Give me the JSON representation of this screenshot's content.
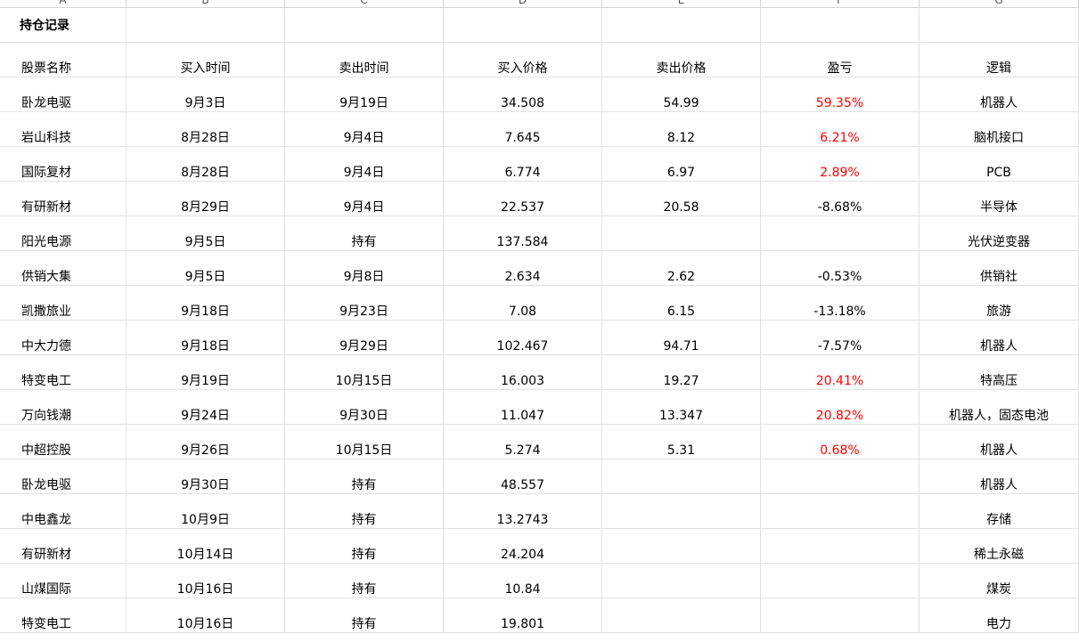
{
  "sheet": {
    "column_letters": [
      "A",
      "B",
      "C",
      "D",
      "E",
      "F",
      "G"
    ],
    "title": "持仓记录",
    "headers": [
      "股票名称",
      "买入时间",
      "卖出时间",
      "买入价格",
      "卖出价格",
      "盈亏",
      "逻辑"
    ],
    "colors": {
      "profit": "#ff0000",
      "loss": "#000000",
      "grid": "#e2e2e2"
    },
    "rows": [
      {
        "name": "卧龙电驱",
        "buy_date": "9月3日",
        "sell_date": "9月19日",
        "buy_price": "34.508",
        "sell_price": "54.99",
        "pnl": "59.35%",
        "pnl_sign": "pos",
        "logic": "机器人"
      },
      {
        "name": "岩山科技",
        "buy_date": "8月28日",
        "sell_date": "9月4日",
        "buy_price": "7.645",
        "sell_price": "8.12",
        "pnl": "6.21%",
        "pnl_sign": "pos",
        "logic": "脑机接口"
      },
      {
        "name": "国际复材",
        "buy_date": "8月28日",
        "sell_date": "9月4日",
        "buy_price": "6.774",
        "sell_price": "6.97",
        "pnl": "2.89%",
        "pnl_sign": "pos",
        "logic": "PCB"
      },
      {
        "name": "有研新材",
        "buy_date": "8月29日",
        "sell_date": "9月4日",
        "buy_price": "22.537",
        "sell_price": "20.58",
        "pnl": "-8.68%",
        "pnl_sign": "neg",
        "logic": "半导体"
      },
      {
        "name": "阳光电源",
        "buy_date": "9月5日",
        "sell_date": "持有",
        "buy_price": "137.584",
        "sell_price": "",
        "pnl": "",
        "pnl_sign": "neg",
        "logic": "光伏逆变器"
      },
      {
        "name": "供销大集",
        "buy_date": "9月5日",
        "sell_date": "9月8日",
        "buy_price": "2.634",
        "sell_price": "2.62",
        "pnl": "-0.53%",
        "pnl_sign": "neg",
        "logic": "供销社"
      },
      {
        "name": "凯撒旅业",
        "buy_date": "9月18日",
        "sell_date": "9月23日",
        "buy_price": "7.08",
        "sell_price": "6.15",
        "pnl": "-13.18%",
        "pnl_sign": "neg",
        "logic": "旅游"
      },
      {
        "name": "中大力德",
        "buy_date": "9月18日",
        "sell_date": "9月29日",
        "buy_price": "102.467",
        "sell_price": "94.71",
        "pnl": "-7.57%",
        "pnl_sign": "neg",
        "logic": "机器人"
      },
      {
        "name": "特变电工",
        "buy_date": "9月19日",
        "sell_date": "10月15日",
        "buy_price": "16.003",
        "sell_price": "19.27",
        "pnl": "20.41%",
        "pnl_sign": "pos",
        "logic": "特高压"
      },
      {
        "name": "万向钱潮",
        "buy_date": "9月24日",
        "sell_date": "9月30日",
        "buy_price": "11.047",
        "sell_price": "13.347",
        "pnl": "20.82%",
        "pnl_sign": "pos",
        "logic": "机器人，固态电池"
      },
      {
        "name": "中超控股",
        "buy_date": "9月26日",
        "sell_date": "10月15日",
        "buy_price": "5.274",
        "sell_price": "5.31",
        "pnl": "0.68%",
        "pnl_sign": "pos",
        "logic": "机器人"
      },
      {
        "name": "卧龙电驱",
        "buy_date": "9月30日",
        "sell_date": "持有",
        "buy_price": "48.557",
        "sell_price": "",
        "pnl": "",
        "pnl_sign": "neg",
        "logic": "机器人"
      },
      {
        "name": "中电鑫龙",
        "buy_date": "10月9日",
        "sell_date": "持有",
        "buy_price": "13.2743",
        "sell_price": "",
        "pnl": "",
        "pnl_sign": "neg",
        "logic": "存储"
      },
      {
        "name": "有研新材",
        "buy_date": "10月14日",
        "sell_date": "持有",
        "buy_price": "24.204",
        "sell_price": "",
        "pnl": "",
        "pnl_sign": "neg",
        "logic": "稀土永磁"
      },
      {
        "name": "山煤国际",
        "buy_date": "10月16日",
        "sell_date": "持有",
        "buy_price": "10.84",
        "sell_price": "",
        "pnl": "",
        "pnl_sign": "neg",
        "logic": "煤炭"
      },
      {
        "name": "特变电工",
        "buy_date": "10月16日",
        "sell_date": "持有",
        "buy_price": "19.801",
        "sell_price": "",
        "pnl": "",
        "pnl_sign": "neg",
        "logic": "电力"
      }
    ]
  }
}
